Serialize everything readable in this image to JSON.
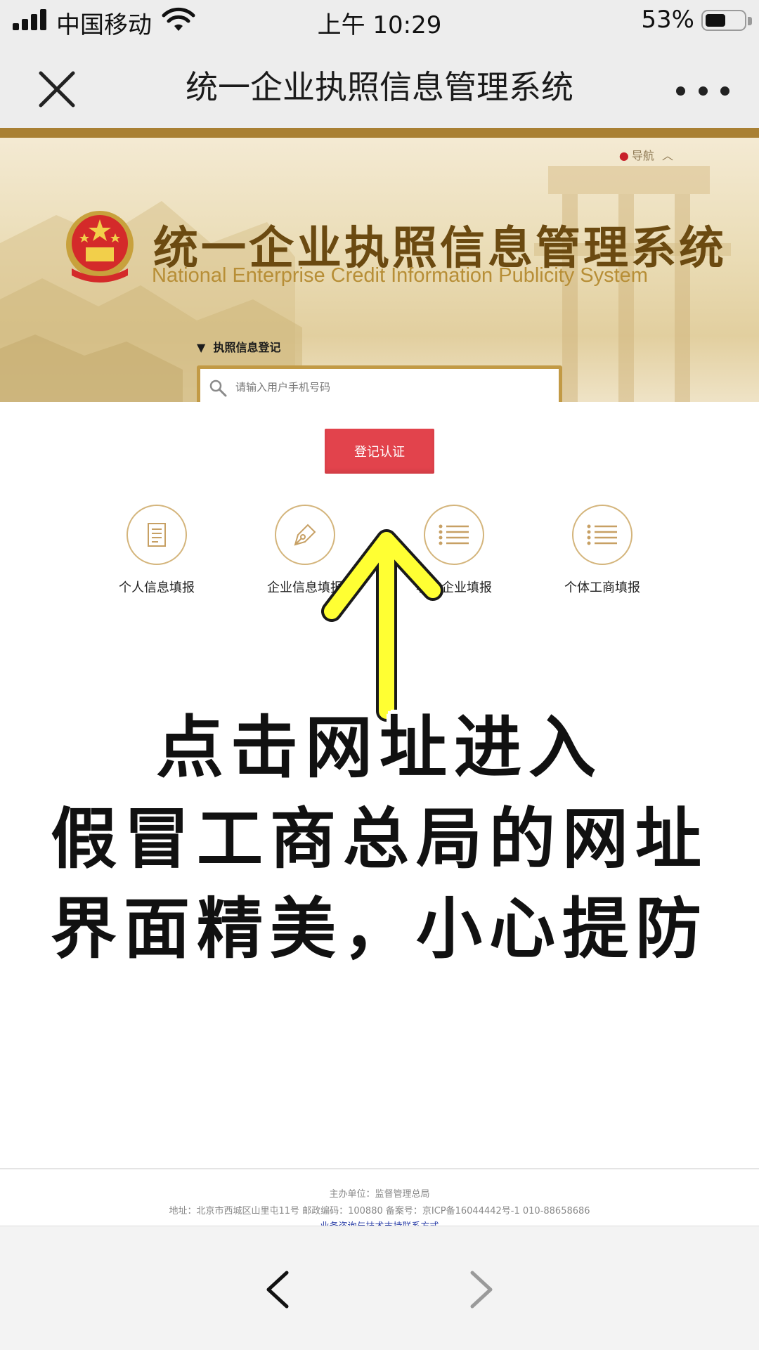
{
  "status_bar": {
    "carrier": "中国移动",
    "time": "上午 10:29",
    "battery_percent": "53%",
    "battery_level": 0.53
  },
  "navbar": {
    "title": "统一企业执照信息管理系统",
    "close_icon": "close-icon",
    "more_icon": "more-dots-icon"
  },
  "hero": {
    "nav_link": "导航",
    "title_cn": "统一企业执照信息管理系统",
    "title_en": "National Enterprise Credit Information Publicity System",
    "register_label": "执照信息登记",
    "search_placeholder": "请输入用户手机号码"
  },
  "submit_button": "登记认证",
  "quick_links": [
    {
      "label": "个人信息填报",
      "icon": "document-icon"
    },
    {
      "label": "企业信息填报",
      "icon": "pen-icon"
    },
    {
      "label": "小微企业填报",
      "icon": "list-icon"
    },
    {
      "label": "个体工商填报",
      "icon": "list-icon"
    }
  ],
  "overlay": {
    "line1": "点击网址进入",
    "line2": "假冒工商总局的网址",
    "line3": "界面精美，小心提防"
  },
  "footer": {
    "host": "主办单位：监督管理总局",
    "address": "地址：北京市西城区山里屯11号    邮政编码：100880    备案号：京ICP备16044442号-1    010-88658686",
    "link": "业务咨询与技术支持联系方式"
  },
  "colors": {
    "accent_gold": "#a98033",
    "button_red": "#e2434c",
    "arrow_yellow": "#ffff33"
  }
}
